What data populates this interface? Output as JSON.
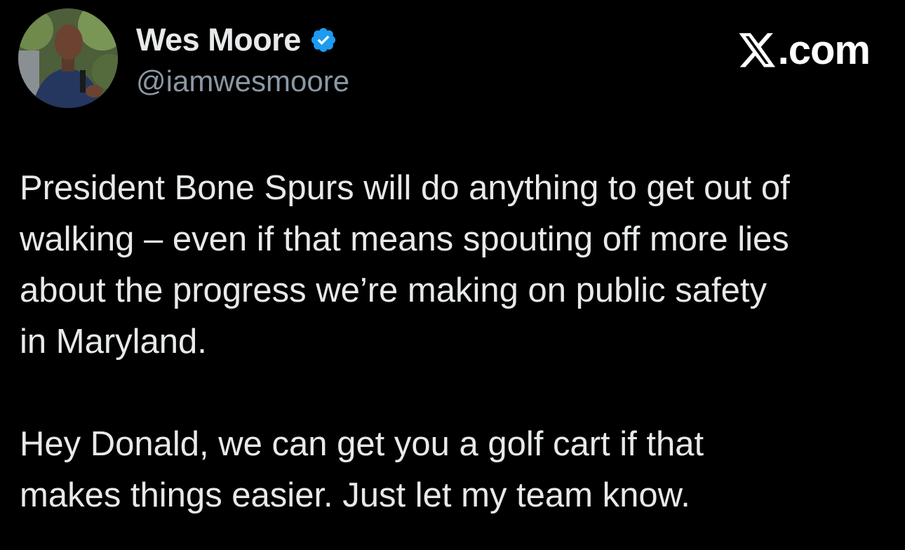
{
  "author": {
    "display_name": "Wes Moore",
    "handle": "@iamwesmoore",
    "verified": true,
    "avatar": "profile-photo"
  },
  "brand": {
    "logo": "x-logo-icon",
    "text": ".com"
  },
  "tweet": {
    "paragraphs": [
      "President Bone Spurs will do anything to get out of\nwalking – even if that means spouting off more lies\nabout the progress we’re making on public safety\nin Maryland.",
      "Hey Donald, we can get you a golf cart if that\nmakes things easier. Just let my team know."
    ]
  },
  "colors": {
    "background": "#000000",
    "text_primary": "#e7e9ea",
    "text_secondary": "#8b98a5",
    "verified_blue": "#1d9bf0"
  }
}
